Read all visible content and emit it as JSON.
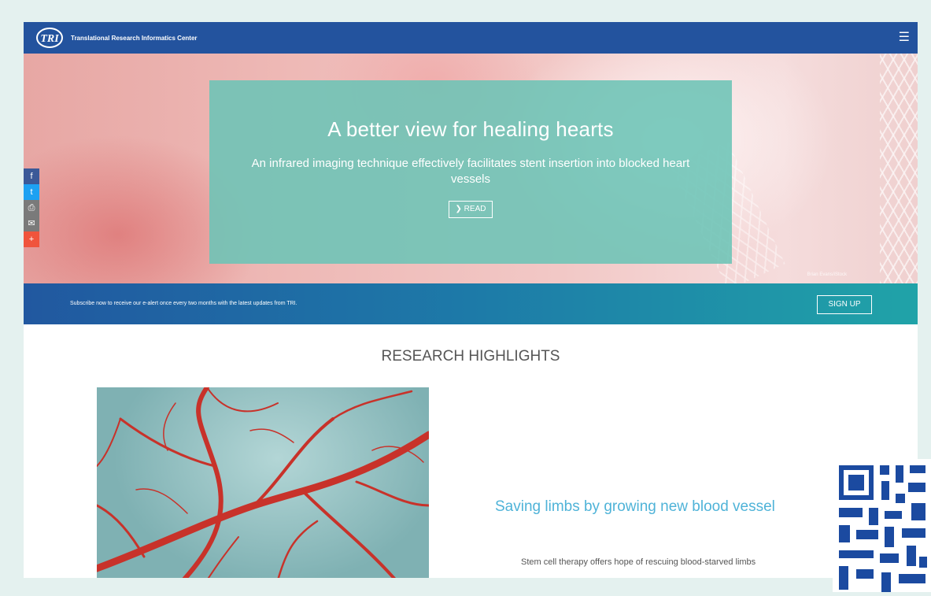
{
  "header": {
    "logo_text": "TRI",
    "site_title": "Translational Research Informatics Center",
    "menu_icon": "hamburger-menu-icon"
  },
  "hero": {
    "title": "A better view for healing hearts",
    "subtitle": "An infrared imaging technique effectively facilitates stent insertion into blocked heart vessels",
    "read_label": "❯ READ",
    "credit": "Brian Evans/iStock"
  },
  "share": {
    "items": [
      {
        "icon": "facebook-icon",
        "glyph": "f",
        "color": "#3b5998"
      },
      {
        "icon": "twitter-icon",
        "glyph": "t",
        "color": "#1da1f2"
      },
      {
        "icon": "print-icon",
        "glyph": "⎙",
        "color": "#7a7a7a"
      },
      {
        "icon": "email-icon",
        "glyph": "✉",
        "color": "#7a7a7a"
      },
      {
        "icon": "more-icon",
        "glyph": "+",
        "color": "#f0543c"
      }
    ]
  },
  "subscribe": {
    "text": "Subscribe now to receive our e-alert once every two months with the latest updates from TRI.",
    "signup_label": "SIGN UP"
  },
  "highlights": {
    "title": "RESEARCH HIGHLIGHTS",
    "feature_title": "Saving limbs by growing new blood vessel",
    "feature_desc": "Stem cell therapy offers hope of rescuing blood-starved limbs"
  },
  "colors": {
    "nav": "#23539e",
    "card": "#6cc4b6",
    "accent_link": "#4fb3d8",
    "background": "#e4f1ef"
  }
}
